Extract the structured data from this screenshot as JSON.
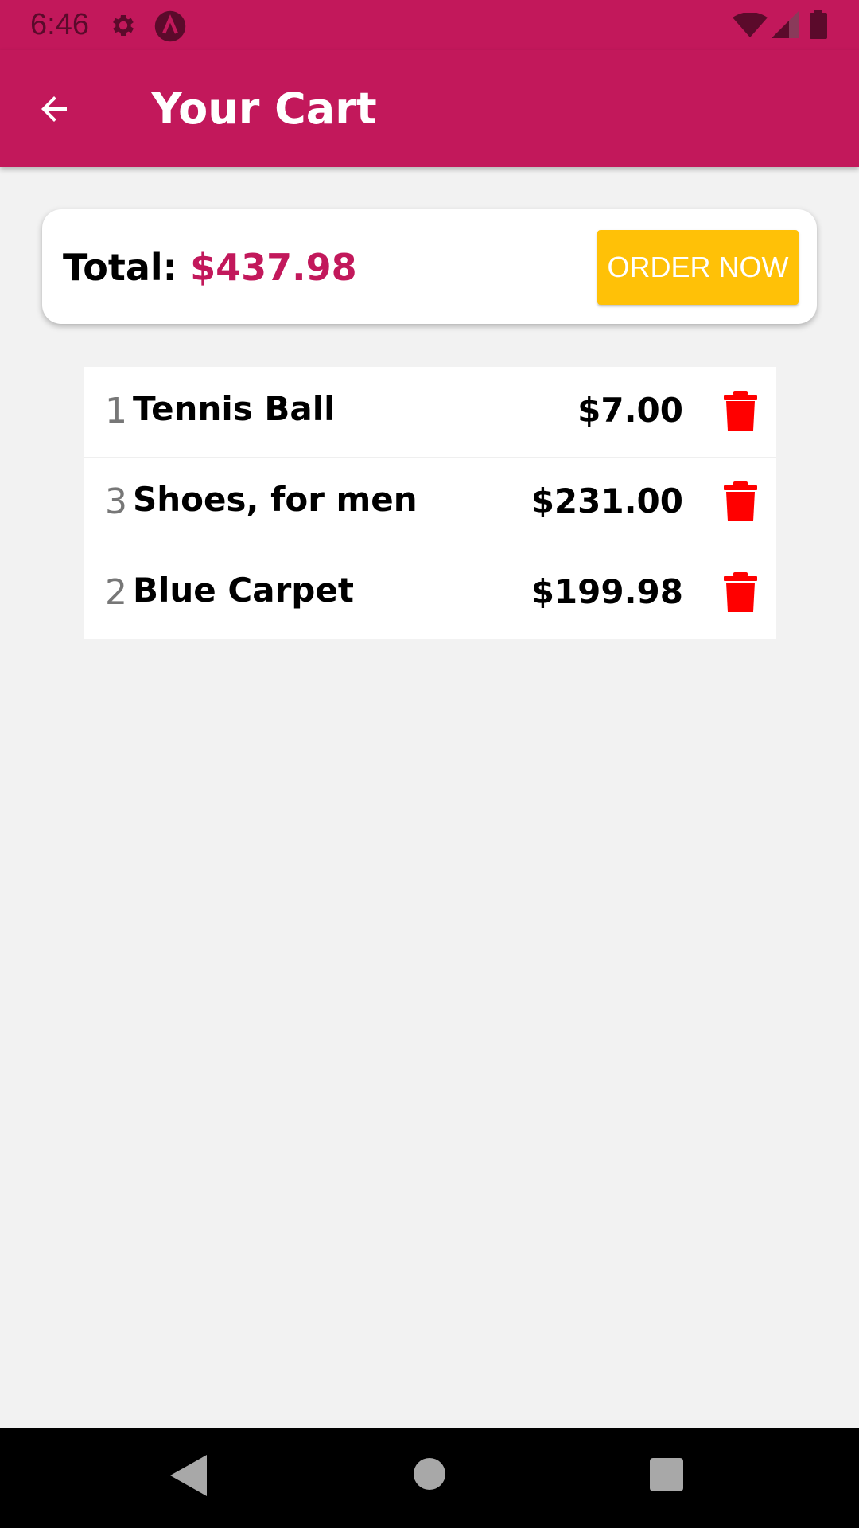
{
  "status_bar": {
    "time": "6:46",
    "icons": [
      "gear-icon",
      "app-a-icon",
      "wifi-icon",
      "signal-icon",
      "battery-icon"
    ]
  },
  "app_bar": {
    "title": "Your Cart",
    "back_icon": "arrow-left-icon"
  },
  "summary": {
    "total_label": "Total:",
    "total_amount": "$437.98",
    "order_button_label": "ORDER NOW"
  },
  "cart": {
    "items": [
      {
        "qty": "1",
        "name": "Tennis Ball",
        "price": "$7.00"
      },
      {
        "qty": "3",
        "name": "Shoes, for men",
        "price": "$231.00"
      },
      {
        "qty": "2",
        "name": "Blue Carpet",
        "price": "$199.98"
      }
    ],
    "delete_icon": "trash-icon"
  },
  "nav_bar": {
    "icons": [
      "nav-back-icon",
      "nav-home-icon",
      "nav-recent-icon"
    ]
  },
  "colors": {
    "primary": "#c2185b",
    "accent": "#ffc107",
    "delete": "#ff0000",
    "background": "#f2f2f2"
  }
}
